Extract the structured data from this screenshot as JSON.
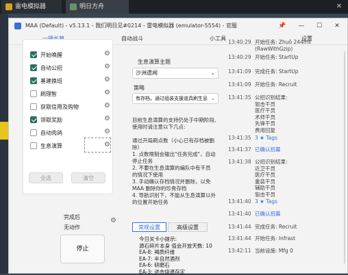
{
  "emulator": {
    "tab1": "雷电模拟器",
    "tab2": "明日方舟",
    "close": "✕"
  },
  "window": {
    "title": "MAA (Default) - v5.13.1 - 我们明日见#0214 - 雷电模拟器 (emulator-5554) - 官服",
    "controls": {
      "pin": "📌",
      "min": "—",
      "max": "☐",
      "close": "✕"
    }
  },
  "tabs": [
    {
      "label": "一键长草"
    },
    {
      "label": "自动战斗"
    },
    {
      "label": "小工具"
    },
    {
      "label": "设置"
    }
  ],
  "tasks": [
    {
      "label": "开始唤醒",
      "checked": true
    },
    {
      "label": "自动公招",
      "checked": true
    },
    {
      "label": "基建换班",
      "checked": true
    },
    {
      "label": "刷理智",
      "checked": false
    },
    {
      "label": "获取信用及购物",
      "checked": false
    },
    {
      "label": "领取奖励",
      "checked": true
    },
    {
      "label": "自动肉鸽",
      "checked": false
    },
    {
      "label": "生息演算",
      "checked": false
    }
  ],
  "left_buttons": {
    "select_all": "全选",
    "clear": "清空"
  },
  "after_complete": {
    "label": "完成后",
    "value": "无动作"
  },
  "stop_button": "停止",
  "reclamation": {
    "theme_label": "生息演算主题",
    "theme_value": "沙洲遗闻",
    "strategy_label": "策略",
    "strategy_value": "有存档，通过组装支援道具刷生息",
    "description": "目前生息演算的支持仍处于中期阶段,\n使用时请注意以下几点:\n\n  通过开局刷点数（小心已有存档被删\n除）\n  1. 点数限制会输出\"任务完成\"，自动\n停止任务\n  2. 不要在生息演算的编队中有干员\n的情况下使用\n  3. 手动确认存档情况并删除，以免\nMAA 删除你的珍贵存档\n  4. 导航识别下，不能从生息演算以外\n的位置开始任务",
    "seg_normal": "常规设置",
    "seg_advanced": "高级设置"
  },
  "tips": "今日关卡小提示:\n源石碎片本身 值会开放天数: 10\nEA-8: 褐质纤维\nEA-7: 半自然酒剂\nEA-6: 研磨石\nEA-3: 进击烧遗存定",
  "log": [
    {
      "time": "13:40:29",
      "msg": "开始任务: Zhuǒ 244ms\n(RawWithGzip)",
      "color": "gray"
    },
    {
      "time": "13:40:29",
      "msg": "开始任务: StartUp",
      "color": "gray"
    },
    {
      "time": "13:41:09",
      "msg": "完成任务: StartUp",
      "color": "gray"
    },
    {
      "time": "13:41:09",
      "msg": "开始任务: Recruit",
      "color": "gray"
    },
    {
      "time": "13:41:35",
      "msg": "公招识别结果:\n狙击干员\n医疗干员\n术师干员\n先锋干员\n费用回复",
      "color": "gray"
    },
    {
      "time": "13:41:35",
      "msg": "3 ★ Tags",
      "color": "blue"
    },
    {
      "time": "13:41:37",
      "msg": "已确认招募",
      "color": "blue"
    },
    {
      "time": "13:41:38",
      "msg": "公招识别结果:\n近卫干员\n医疗干员\n重装干员\n辅助干员\n狙击干员",
      "color": "gray"
    },
    {
      "time": "13:41:40",
      "msg": "3 ★ Tags",
      "color": "blue"
    },
    {
      "time": "13:41:40",
      "msg": "已确认招募",
      "color": "blue"
    },
    {
      "time": "13:41:44",
      "msg": "完成任务: Recruit",
      "color": "gray"
    },
    {
      "time": "13:41:44",
      "msg": "开始任务: Infrast",
      "color": "gray"
    },
    {
      "time": "13:42:11",
      "msg": "当前设施: Mfg 0",
      "color": "gray"
    }
  ],
  "colors": {
    "accent": "#3a6fd8",
    "checkbox": "#2f6e63",
    "emulator_bg": "#1c2026"
  }
}
